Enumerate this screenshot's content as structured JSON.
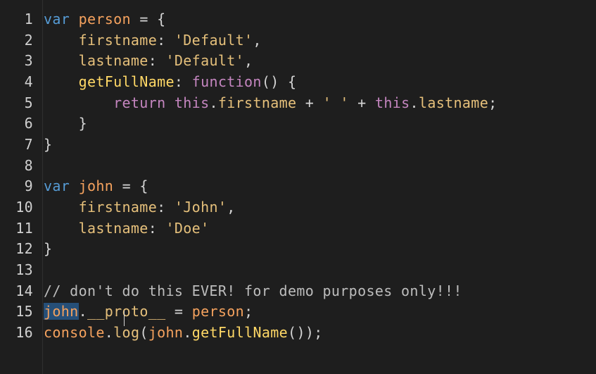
{
  "editor": {
    "lines": [
      {
        "number": "1",
        "tokens": [
          {
            "text": "var",
            "type": "keyword"
          },
          {
            "text": " ",
            "type": "plain"
          },
          {
            "text": "person",
            "type": "decl"
          },
          {
            "text": " = {",
            "type": "punc"
          }
        ]
      },
      {
        "number": "2",
        "tokens": [
          {
            "text": "    firstname",
            "type": "prop"
          },
          {
            "text": ": ",
            "type": "punc"
          },
          {
            "text": "'Default'",
            "type": "string"
          },
          {
            "text": ",",
            "type": "punc"
          }
        ]
      },
      {
        "number": "3",
        "tokens": [
          {
            "text": "    lastname",
            "type": "prop"
          },
          {
            "text": ": ",
            "type": "punc"
          },
          {
            "text": "'Default'",
            "type": "string"
          },
          {
            "text": ",",
            "type": "punc"
          }
        ]
      },
      {
        "number": "4",
        "tokens": [
          {
            "text": "    getFullName",
            "type": "method"
          },
          {
            "text": ": ",
            "type": "punc"
          },
          {
            "text": "function",
            "type": "func"
          },
          {
            "text": "() {",
            "type": "punc"
          }
        ]
      },
      {
        "number": "5",
        "tokens": [
          {
            "text": "        return",
            "type": "func"
          },
          {
            "text": " ",
            "type": "plain"
          },
          {
            "text": "this",
            "type": "this"
          },
          {
            "text": ".",
            "type": "punc"
          },
          {
            "text": "firstname",
            "type": "prop"
          },
          {
            "text": " + ",
            "type": "punc"
          },
          {
            "text": "' '",
            "type": "string"
          },
          {
            "text": " + ",
            "type": "punc"
          },
          {
            "text": "this",
            "type": "this"
          },
          {
            "text": ".",
            "type": "punc"
          },
          {
            "text": "lastname",
            "type": "prop"
          },
          {
            "text": ";",
            "type": "punc"
          }
        ]
      },
      {
        "number": "6",
        "tokens": [
          {
            "text": "    }",
            "type": "punc"
          }
        ]
      },
      {
        "number": "7",
        "tokens": [
          {
            "text": "}",
            "type": "punc"
          }
        ]
      },
      {
        "number": "8",
        "tokens": []
      },
      {
        "number": "9",
        "tokens": [
          {
            "text": "var",
            "type": "keyword"
          },
          {
            "text": " ",
            "type": "plain"
          },
          {
            "text": "john",
            "type": "decl"
          },
          {
            "text": " = {",
            "type": "punc"
          }
        ]
      },
      {
        "number": "10",
        "tokens": [
          {
            "text": "    firstname",
            "type": "prop"
          },
          {
            "text": ": ",
            "type": "punc"
          },
          {
            "text": "'John'",
            "type": "string"
          },
          {
            "text": ",",
            "type": "punc"
          }
        ]
      },
      {
        "number": "11",
        "tokens": [
          {
            "text": "    lastname",
            "type": "prop"
          },
          {
            "text": ": ",
            "type": "punc"
          },
          {
            "text": "'Doe'",
            "type": "string"
          }
        ]
      },
      {
        "number": "12",
        "tokens": [
          {
            "text": "}",
            "type": "punc"
          }
        ]
      },
      {
        "number": "13",
        "tokens": []
      },
      {
        "number": "14",
        "tokens": [
          {
            "text": "// don't do this EVER! for demo purposes only!!!",
            "type": "comment"
          }
        ]
      },
      {
        "number": "15",
        "tokens": [
          {
            "text": "john",
            "type": "decl",
            "selected": true
          },
          {
            "text": ".",
            "type": "punc"
          },
          {
            "text": "__proto__",
            "type": "prop"
          },
          {
            "text": " = ",
            "type": "punc"
          },
          {
            "text": "person",
            "type": "decl"
          },
          {
            "text": ";",
            "type": "punc"
          }
        ]
      },
      {
        "number": "16",
        "tokens": [
          {
            "text": "console",
            "type": "decl"
          },
          {
            "text": ".",
            "type": "punc"
          },
          {
            "text": "log",
            "type": "prop"
          },
          {
            "text": "(",
            "type": "punc"
          },
          {
            "text": "john",
            "type": "decl"
          },
          {
            "text": ".",
            "type": "punc"
          },
          {
            "text": "getFullName",
            "type": "method"
          },
          {
            "text": "());",
            "type": "punc"
          }
        ]
      }
    ]
  }
}
